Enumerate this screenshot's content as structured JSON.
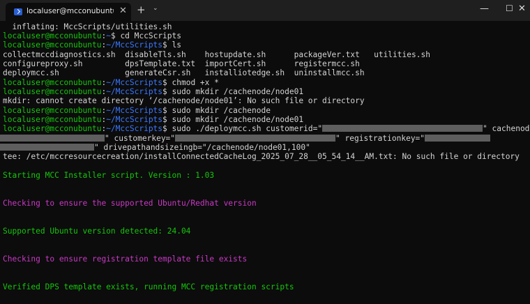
{
  "window": {
    "tab_title": "localuser@mcconubuntu: ~/M",
    "tab_close": "✕",
    "new_tab": "+",
    "dropdown": "⌄",
    "minimize": "—",
    "maximize": "☐",
    "close": "✕"
  },
  "terminal": {
    "prompt_user": "localuser@mcconubuntu",
    "prompt_sep": ":",
    "home_path": "~",
    "scripts_path": "~/MccScripts",
    "prompt_end": "$ ",
    "l0": "  inflating: MccScripts/utilities.sh",
    "cmd_cd": "cd MccScripts",
    "cmd_ls": "ls",
    "ls1": "collectmccdiagnostics.sh  disableTls.sh    hostupdate.sh      packageVer.txt   utilities.sh",
    "ls2": "configureproxy.sh         dpsTemplate.txt  importCert.sh      registermcc.sh",
    "ls3": "deploymcc.sh              generateCsr.sh   installiotedge.sh  uninstallmcc.sh",
    "cmd_chmod": "chmod +x *",
    "cmd_mkdir1": "sudo mkdir /cachenode/node01",
    "err1": "mkdir: cannot create directory ‘/cachenode/node01’: No such file or directory",
    "cmd_mkdir2": "sudo mkdir /cachenode",
    "cmd_mkdir3": "sudo mkdir /cachenode/node01",
    "cmd_deploy": "sudo ./deploymcc.sh customerid=\"",
    "deploy_cachenodeid": "\" cachenodeid=\"",
    "customerkey": "\" customerkey=\"",
    "registrationkey": "\" registrationkey=\"",
    "drivepath": "\" drivepathandsizeingb=\"/cachenode/node01,100\"",
    "tee": "tee: /etc/mccresourcecreation/installConnectedCacheLog_2025_07_28__05_54_14__AM.txt: No such file or directory",
    "out1": "Starting MCC Installer script. Version : 1.03",
    "out2": "Checking to ensure the supported Ubuntu/Redhat version",
    "out3": "Supported Ubuntu version detected: 24.04",
    "out4": "Checking to ensure registration template file exists",
    "out5": "Verified DPS template exists, running MCC registration scripts",
    "colors": {
      "user": "#16c60c",
      "path": "#3b78ff",
      "magenta": "#c839c5",
      "text": "#d4d4d4"
    }
  }
}
